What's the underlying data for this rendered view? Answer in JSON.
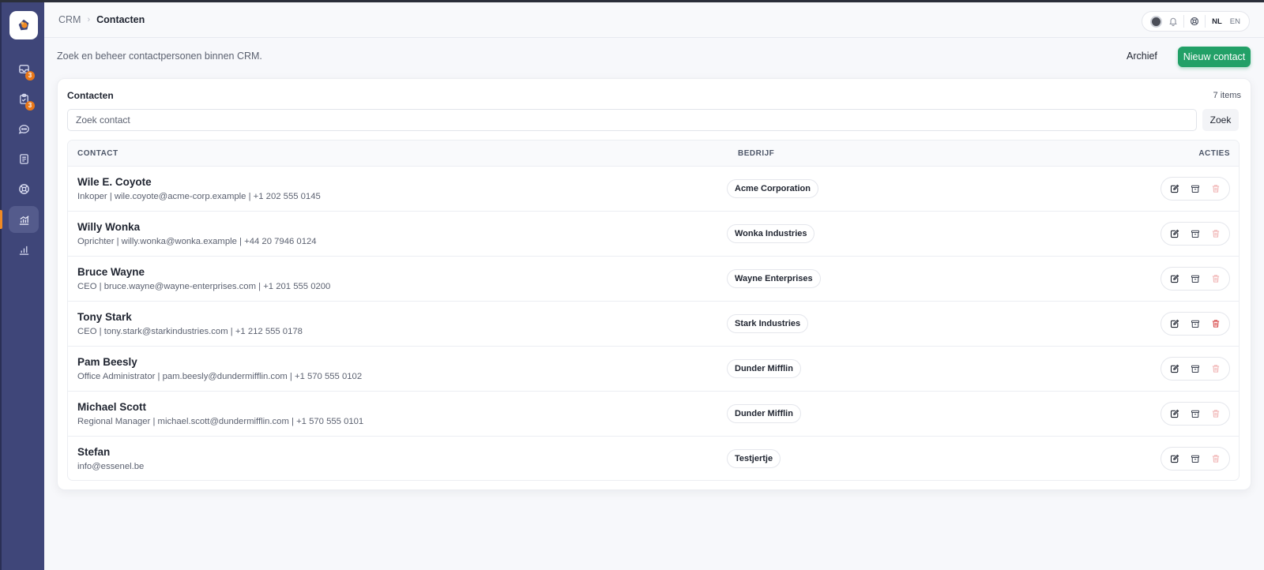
{
  "header": {
    "breadcrumbs": [
      "CRM",
      "Contacten"
    ],
    "languages": [
      "NL",
      "EN"
    ],
    "active_language": "NL"
  },
  "sidebar": {
    "items": [
      {
        "icon": "inbox-icon",
        "badge": "3"
      },
      {
        "icon": "clipboard-icon",
        "badge": "3"
      },
      {
        "icon": "chat-icon",
        "badge": ""
      },
      {
        "icon": "document-icon",
        "badge": ""
      },
      {
        "icon": "support-icon",
        "badge": ""
      },
      {
        "icon": "crm-chart-icon",
        "badge": "",
        "active": true
      },
      {
        "icon": "bar-chart-icon",
        "badge": ""
      }
    ]
  },
  "main": {
    "subtitle": "Zoek en beheer contactpersonen binnen CRM.",
    "archive_label": "Archief",
    "new_contact_label": "Nieuw contact"
  },
  "card": {
    "title": "Contacten",
    "count": "7 items",
    "search_placeholder": "Zoek contact",
    "search_button": "Zoek",
    "columns": [
      "CONTACT",
      "BEDRIJF",
      "ACTIES"
    ],
    "rows": [
      {
        "name": "Wile E. Coyote",
        "meta": "Inkoper | wile.coyote@acme-corp.example | +1 202 555 0145",
        "company": "Acme Corporation"
      },
      {
        "name": "Willy Wonka",
        "meta": "Oprichter | willy.wonka@wonka.example | +44 20 7946 0124",
        "company": "Wonka Industries"
      },
      {
        "name": "Bruce Wayne",
        "meta": "CEO | bruce.wayne@wayne-enterprises.com | +1 201 555 0200",
        "company": "Wayne Enterprises"
      },
      {
        "name": "Tony Stark",
        "meta": "CEO | tony.stark@starkindustries.com | +1 212 555 0178",
        "company": "Stark Industries"
      },
      {
        "name": "Pam Beesly",
        "meta": "Office Administrator | pam.beesly@dundermifflin.com | +1 570 555 0102",
        "company": "Dunder Mifflin"
      },
      {
        "name": "Michael Scott",
        "meta": "Regional Manager | michael.scott@dundermifflin.com | +1 570 555 0101",
        "company": "Dunder Mifflin"
      },
      {
        "name": "Stefan",
        "meta": "info@essenel.be",
        "company": "Testjertje"
      }
    ]
  },
  "colors": {
    "sidebar": "#3f4679",
    "accent": "#22a067",
    "badge": "#e9781a",
    "delete_active": "#d64545",
    "delete_muted": "#f0b3b3"
  }
}
